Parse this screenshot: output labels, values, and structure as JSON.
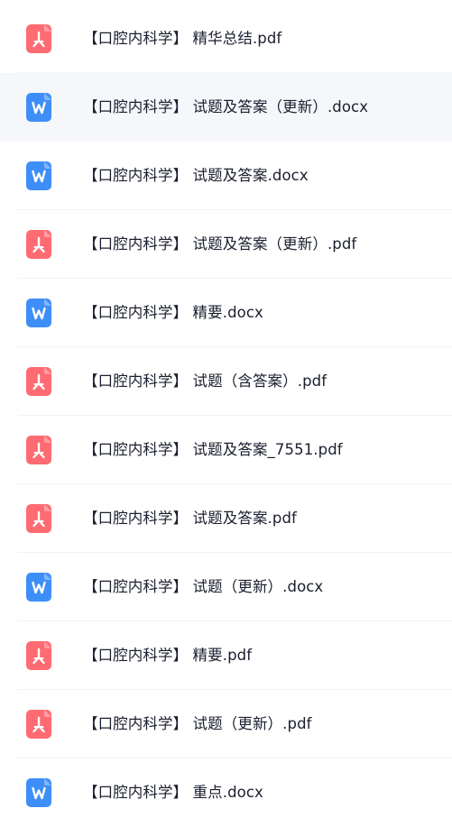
{
  "colors": {
    "pdf_icon": "#ff6b72",
    "word_icon": "#3e8ef7",
    "highlight_row": "#f6f7fa",
    "text": "#1b1f2e"
  },
  "files": [
    {
      "name": "【口腔内科学】 精华总结.pdf",
      "type": "pdf",
      "icon": "pdf-icon",
      "highlighted": false
    },
    {
      "name": "【口腔内科学】 试题及答案（更新）.docx",
      "type": "docx",
      "icon": "word-icon",
      "highlighted": true
    },
    {
      "name": "【口腔内科学】 试题及答案.docx",
      "type": "docx",
      "icon": "word-icon",
      "highlighted": false
    },
    {
      "name": "【口腔内科学】 试题及答案（更新）.pdf",
      "type": "pdf",
      "icon": "pdf-icon",
      "highlighted": false
    },
    {
      "name": "【口腔内科学】 精要.docx",
      "type": "docx",
      "icon": "word-icon",
      "highlighted": false
    },
    {
      "name": "【口腔内科学】 试题（含答案）.pdf",
      "type": "pdf",
      "icon": "pdf-icon",
      "highlighted": false
    },
    {
      "name": "【口腔内科学】 试题及答案_7551.pdf",
      "type": "pdf",
      "icon": "pdf-icon",
      "highlighted": false
    },
    {
      "name": "【口腔内科学】 试题及答案.pdf",
      "type": "pdf",
      "icon": "pdf-icon",
      "highlighted": false
    },
    {
      "name": "【口腔内科学】 试题（更新）.docx",
      "type": "docx",
      "icon": "word-icon",
      "highlighted": false
    },
    {
      "name": "【口腔内科学】 精要.pdf",
      "type": "pdf",
      "icon": "pdf-icon",
      "highlighted": false
    },
    {
      "name": "【口腔内科学】 试题（更新）.pdf",
      "type": "pdf",
      "icon": "pdf-icon",
      "highlighted": false
    },
    {
      "name": "【口腔内科学】 重点.docx",
      "type": "docx",
      "icon": "word-icon",
      "highlighted": false
    }
  ]
}
